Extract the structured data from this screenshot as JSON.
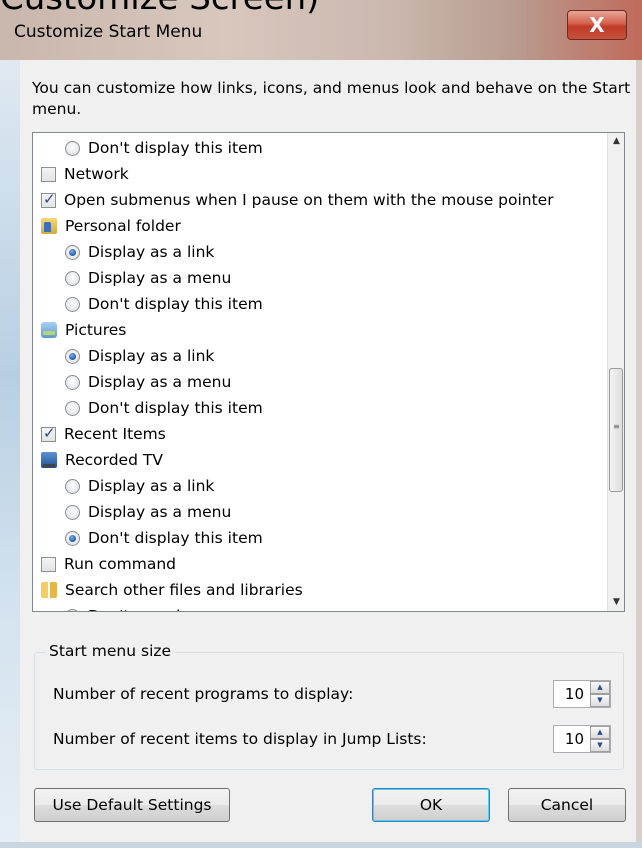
{
  "window": {
    "background_heading": "Customize Screen)",
    "title": "Customize Start Menu",
    "close_glyph": "X",
    "close_icon": "close-icon"
  },
  "description": "You can customize how links, icons, and menus look and behave on the Start menu.",
  "list": {
    "items": [
      {
        "type": "radio",
        "checked": false,
        "label": "Don't display this item"
      },
      {
        "type": "checkbox",
        "checked": false,
        "label": "Network"
      },
      {
        "type": "checkbox",
        "checked": true,
        "label": "Open submenus when I pause on them with the mouse pointer"
      },
      {
        "type": "header",
        "icon": "personal-folder-icon",
        "label": "Personal folder"
      },
      {
        "type": "radio",
        "checked": true,
        "label": "Display as a link"
      },
      {
        "type": "radio",
        "checked": false,
        "label": "Display as a menu"
      },
      {
        "type": "radio",
        "checked": false,
        "label": "Don't display this item"
      },
      {
        "type": "header",
        "icon": "pictures-icon",
        "label": "Pictures"
      },
      {
        "type": "radio",
        "checked": true,
        "label": "Display as a link"
      },
      {
        "type": "radio",
        "checked": false,
        "label": "Display as a menu"
      },
      {
        "type": "radio",
        "checked": false,
        "label": "Don't display this item"
      },
      {
        "type": "checkbox",
        "checked": true,
        "label": "Recent Items"
      },
      {
        "type": "header",
        "icon": "recorded-tv-icon",
        "label": "Recorded TV"
      },
      {
        "type": "radio",
        "checked": false,
        "label": "Display as a link"
      },
      {
        "type": "radio",
        "checked": false,
        "label": "Display as a menu"
      },
      {
        "type": "radio",
        "checked": true,
        "label": "Don't display this item"
      },
      {
        "type": "checkbox",
        "checked": false,
        "label": "Run command"
      },
      {
        "type": "header",
        "icon": "search-libraries-icon",
        "label": "Search other files and libraries"
      },
      {
        "type": "radio",
        "checked": false,
        "label": "Don't search"
      }
    ],
    "scroll": {
      "up_glyph": "▲",
      "down_glyph": "▼",
      "grip_glyph": "≡"
    }
  },
  "start_menu_size": {
    "title": "Start menu size",
    "recent_programs": {
      "label": "Number of recent programs to display:",
      "value": "10"
    },
    "recent_items": {
      "label": "Number of recent items to display in Jump Lists:",
      "value": "10"
    },
    "spin_up_glyph": "▲",
    "spin_down_glyph": "▼"
  },
  "buttons": {
    "defaults": "Use Default Settings",
    "ok": "OK",
    "cancel": "Cancel"
  }
}
